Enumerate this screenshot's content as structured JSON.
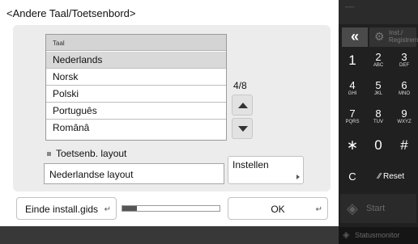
{
  "title": "<Andere Taal/Toetsenbord>",
  "language_list": {
    "header": "Taal",
    "items": [
      "Nederlands",
      "Norsk",
      "Polski",
      "Português",
      "Românâ"
    ],
    "selected_index": 0
  },
  "pagination": {
    "text": "4/8"
  },
  "keyboard": {
    "label": "Toetsenb. layout",
    "value": "Nederlandse layout",
    "set_button": "Instellen"
  },
  "footer": {
    "end_guide_button": "Einde install.gids",
    "progress_fraction": 0.15,
    "ok_button": "OK"
  },
  "right_panel": {
    "top_text": "-----",
    "back_symbol": "«",
    "registration_label": "Inst./ Registrem",
    "keys": [
      {
        "digit": "1",
        "letters": ""
      },
      {
        "digit": "2",
        "letters": "ABC"
      },
      {
        "digit": "3",
        "letters": "DEF"
      },
      {
        "digit": "4",
        "letters": "GHI"
      },
      {
        "digit": "5",
        "letters": "JKL"
      },
      {
        "digit": "6",
        "letters": "MNO"
      },
      {
        "digit": "7",
        "letters": "PQRS"
      },
      {
        "digit": "8",
        "letters": "TUV"
      },
      {
        "digit": "9",
        "letters": "WXYZ"
      },
      {
        "digit": "∗",
        "letters": ""
      },
      {
        "digit": "0",
        "letters": ""
      },
      {
        "digit": "#",
        "letters": ""
      }
    ],
    "clear_key": "C",
    "reset_button": "Reset",
    "start_button": "Start",
    "status_monitor": "Statusmonitor"
  },
  "colors": {
    "panel_bg": "#ececec",
    "selected_row": "#d9d9d9",
    "keypad_bg": "#202020"
  }
}
